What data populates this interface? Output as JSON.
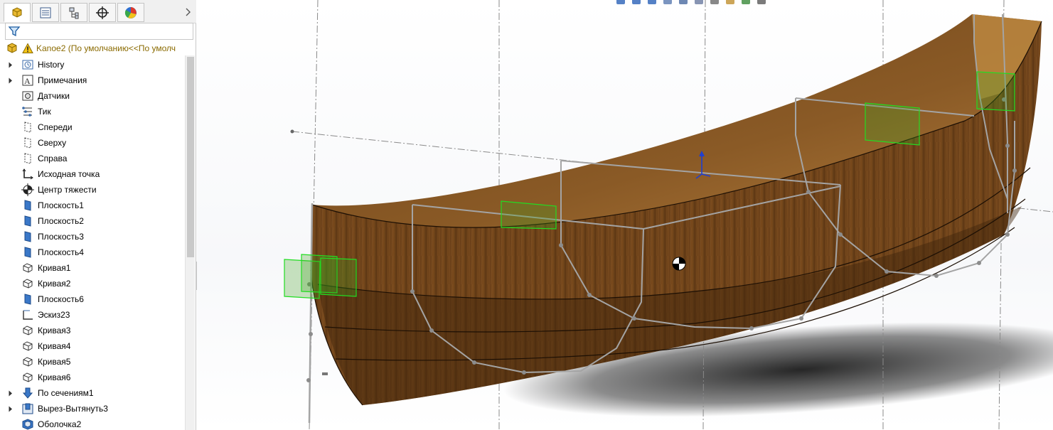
{
  "panel": {
    "tabs": [
      {
        "icon": "feature-manager-icon",
        "active": true
      },
      {
        "icon": "property-manager-icon",
        "active": false
      },
      {
        "icon": "configuration-manager-icon",
        "active": false
      },
      {
        "icon": "dimxpert-icon",
        "active": false
      },
      {
        "icon": "display-manager-icon",
        "active": false
      }
    ],
    "filter": {
      "value": "",
      "icon": "filter-icon"
    },
    "root": {
      "label": "Kanoe2  (По умолчанию<<По умолч",
      "icon": "part-icon",
      "warning": true
    },
    "tree": [
      {
        "label": "History",
        "icon": "history-icon",
        "expandable": true
      },
      {
        "label": "Примечания",
        "icon": "annotations-icon",
        "expandable": true
      },
      {
        "label": "Датчики",
        "icon": "sensors-icon",
        "expandable": false
      },
      {
        "label": "Тик",
        "icon": "material-icon",
        "expandable": false
      },
      {
        "label": "Спереди",
        "icon": "plane-icon",
        "expandable": false
      },
      {
        "label": "Сверху",
        "icon": "plane-icon",
        "expandable": false
      },
      {
        "label": "Справа",
        "icon": "plane-icon",
        "expandable": false
      },
      {
        "label": "Исходная точка",
        "icon": "origin-icon",
        "expandable": false
      },
      {
        "label": "Центр тяжести",
        "icon": "center-of-mass-icon",
        "expandable": false
      },
      {
        "label": "Плоскость1",
        "icon": "ref-plane-icon",
        "expandable": false
      },
      {
        "label": "Плоскость2",
        "icon": "ref-plane-icon",
        "expandable": false
      },
      {
        "label": "Плоскость3",
        "icon": "ref-plane-icon",
        "expandable": false
      },
      {
        "label": "Плоскость4",
        "icon": "ref-plane-icon",
        "expandable": false
      },
      {
        "label": "Кривая1",
        "icon": "curve-icon",
        "expandable": false
      },
      {
        "label": "Кривая2",
        "icon": "curve-icon",
        "expandable": false
      },
      {
        "label": "Плоскость6",
        "icon": "ref-plane-icon",
        "expandable": false
      },
      {
        "label": "Эскиз23",
        "icon": "sketch-icon",
        "expandable": false
      },
      {
        "label": "Кривая3",
        "icon": "curve-icon",
        "expandable": false
      },
      {
        "label": "Кривая4",
        "icon": "curve-icon",
        "expandable": false
      },
      {
        "label": "Кривая5",
        "icon": "curve-icon",
        "expandable": false
      },
      {
        "label": "Кривая6",
        "icon": "curve-icon",
        "expandable": false
      },
      {
        "label": "По сечениям1",
        "icon": "loft-icon",
        "expandable": true
      },
      {
        "label": "Вырез-Вытянуть3",
        "icon": "cut-extrude-icon",
        "expandable": true
      },
      {
        "label": "Оболочка2",
        "icon": "shell-icon",
        "expandable": false
      }
    ]
  },
  "viewport": {
    "model": "canoe hull",
    "material_color": "#6b4019",
    "wire_color": "#a0a0a0",
    "plane_color": "#22dd22",
    "toolbar_icons": [
      "zoom-to-fit-icon",
      "zoom-area-icon",
      "previous-view-icon",
      "section-view-icon",
      "view-orientation-icon",
      "display-style-icon",
      "hide-show-icon",
      "edit-appearance-icon",
      "apply-scene-icon",
      "view-settings-icon"
    ]
  }
}
